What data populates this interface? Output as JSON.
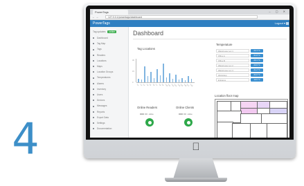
{
  "step_number": "4",
  "browser": {
    "tab_title": "PowerTags",
    "url": "127.0.0.1/powertags/dashboard",
    "window_controls": "– ▢ ✕",
    "nav_arrows": "← →"
  },
  "header": {
    "brand": "PowerTags",
    "user_menu": "Logout ▾"
  },
  "sidebar": {
    "status_label": "Tag updates",
    "status_badge": "online",
    "items": [
      {
        "label": "Dashboard"
      },
      {
        "label": "Tag Map"
      },
      {
        "label": "Tags"
      },
      {
        "label": "Readers"
      },
      {
        "label": "Locations"
      },
      {
        "label": "Maps"
      },
      {
        "label": "Location Groups"
      },
      {
        "label": "Temperatures"
      },
      {
        "label": "Alarms"
      },
      {
        "label": "Inventory"
      },
      {
        "label": "Users"
      },
      {
        "label": "Devices"
      },
      {
        "label": "Messages"
      },
      {
        "label": "Reports"
      },
      {
        "label": "Export Data"
      },
      {
        "label": "Settings"
      },
      {
        "label": "Documentation"
      }
    ]
  },
  "main": {
    "page_title": "Dashboard",
    "tag_locations_title": "Tag Locations",
    "temperature_title": "Temperature",
    "floor_map_title": "Location floor map",
    "online_readers_title": "Online Readers",
    "online_clients_title": "Online Clients",
    "readers_stat": "online",
    "clients_stat": "online",
    "temperatures": [
      {
        "name": "Warehouse Loc 1",
        "value": "22.4 °C"
      },
      {
        "name": "Office A",
        "value": "21.8 °C"
      },
      {
        "name": "Office B",
        "value": "23.1 °C"
      },
      {
        "name": "Warehouse Loc 2",
        "value": "20.9 °C"
      },
      {
        "name": "Warehouse Loc 3",
        "value": "21.2 °C"
      },
      {
        "name": "Workshop",
        "value": "24.0 °C"
      },
      {
        "name": "Entrance",
        "value": "19.6 °C"
      }
    ]
  },
  "chart_data": {
    "type": "bar",
    "title": "Tag Locations",
    "categories": [
      "L1",
      "L2",
      "L3",
      "L4",
      "L5",
      "L6",
      "L7",
      "L8",
      "L9",
      "L10",
      "L11",
      "L12",
      "L13",
      "L14",
      "L15",
      "L16",
      "L17",
      "L18"
    ],
    "values": [
      5,
      4,
      22,
      8,
      14,
      6,
      18,
      9,
      25,
      7,
      12,
      5,
      10,
      4,
      6,
      3,
      8,
      5
    ],
    "ylim": [
      0,
      30
    ]
  },
  "colors": {
    "accent": "#2f7fc1",
    "online_green": "#2ea84a",
    "badge_green": "#3dae4f",
    "step_number": "#3d8fc8"
  },
  "icons": {
    "apple_logo": "apple-logo"
  }
}
